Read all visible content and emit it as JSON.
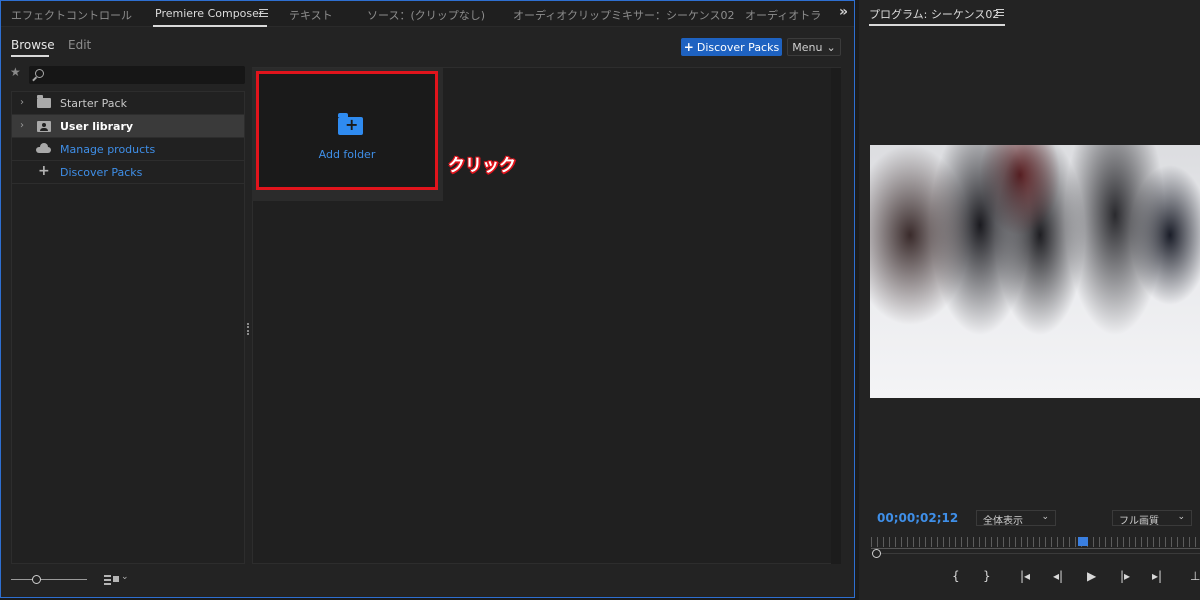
{
  "tabs": [
    {
      "label": "エフェクトコントロール"
    },
    {
      "label": "Premiere Composer"
    },
    {
      "label": "テキスト"
    },
    {
      "label": "ソース：(クリップなし)"
    },
    {
      "label": "オーディオクリップミキサー：シーケンス02"
    },
    {
      "label": "オーディオトラ"
    }
  ],
  "overflow_glyph": "»",
  "subtabs": {
    "browse": "Browse",
    "edit": "Edit"
  },
  "toolbar": {
    "discover_label": "Discover Packs",
    "discover_plus": "+",
    "menu_label": "Menu",
    "menu_chevron": "⌄"
  },
  "search": {
    "placeholder": ""
  },
  "sidebar": {
    "items": [
      {
        "label": "Starter Pack",
        "chevron": "›"
      },
      {
        "label": "User library",
        "chevron": "›"
      },
      {
        "label": "Manage products"
      },
      {
        "label": "Discover Packs",
        "icon": "+"
      }
    ]
  },
  "content": {
    "add_folder_label": "Add folder",
    "add_folder_plus": "+"
  },
  "annotation": {
    "text": "クリック"
  },
  "monitor": {
    "title": "プログラム: シーケンス02",
    "timecode": "00;00;02;12",
    "zoom": "全体表示",
    "quality": "フル画質",
    "select_chevron": "⌄",
    "transport": [
      {
        "name": "mark-in-button",
        "glyph": "{"
      },
      {
        "name": "mark-out-button",
        "glyph": "}"
      },
      {
        "name": "go-to-in-button",
        "glyph": "|◂"
      },
      {
        "name": "step-back-button",
        "glyph": "◂|"
      },
      {
        "name": "play-button",
        "glyph": "▶"
      },
      {
        "name": "step-forward-button",
        "glyph": "|▸"
      },
      {
        "name": "go-to-out-button",
        "glyph": "▸|"
      },
      {
        "name": "lift-button",
        "glyph": "⊥"
      }
    ]
  },
  "colors": {
    "accent": "#1e62c1",
    "link": "#3f8fe8",
    "highlight": "#e1141c",
    "panel_border": "#2e6fd1"
  }
}
